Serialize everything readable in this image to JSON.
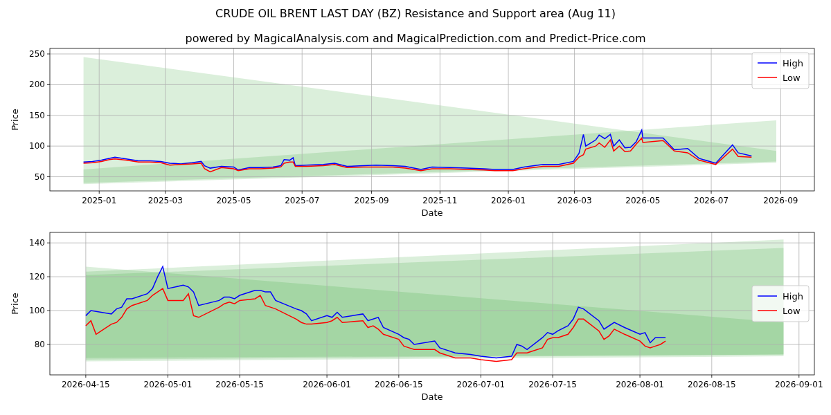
{
  "figure": {
    "title": "CRUDE OIL BRENT LAST DAY (BZ) Resistance and Support area (Aug 11)",
    "subtitle": "powered by MagicalAnalysis.com and MagicalPrediction.com and Predict-Price.com"
  },
  "charts": [
    {
      "chart_data": {
        "type": "line",
        "xlabel": "Date",
        "ylabel": "Price",
        "x": [
          "2024-12-18",
          "2024-12-26",
          "2025-01-03",
          "2025-01-10",
          "2025-01-15",
          "2025-01-25",
          "2025-02-05",
          "2025-02-15",
          "2025-02-25",
          "2025-03-05",
          "2025-03-15",
          "2025-03-25",
          "2025-04-02",
          "2025-04-05",
          "2025-04-10",
          "2025-04-20",
          "2025-05-01",
          "2025-05-05",
          "2025-05-15",
          "2025-05-25",
          "2025-06-05",
          "2025-06-12",
          "2025-06-15",
          "2025-06-20",
          "2025-06-23",
          "2025-06-25",
          "2025-07-05",
          "2025-07-20",
          "2025-07-30",
          "2025-08-10",
          "2025-08-25",
          "2025-09-05",
          "2025-09-20",
          "2025-10-01",
          "2025-10-15",
          "2025-10-25",
          "2025-11-10",
          "2025-11-25",
          "2025-12-10",
          "2025-12-20",
          "2026-01-05",
          "2026-01-15",
          "2026-02-01",
          "2026-02-15",
          "2026-02-28",
          "2026-03-05",
          "2026-03-09",
          "2026-03-11",
          "2026-03-20",
          "2026-03-23",
          "2026-03-28",
          "2026-04-02",
          "2026-04-05",
          "2026-04-10",
          "2026-04-15",
          "2026-04-20",
          "2026-04-25",
          "2026-04-30",
          "2026-05-01",
          "2026-05-19",
          "2026-05-29",
          "2026-06-10",
          "2026-06-20",
          "2026-07-05",
          "2026-07-20",
          "2026-07-25",
          "2026-08-06"
        ],
        "series": [
          {
            "name": "High",
            "color": "#0000ff",
            "values": [
              74,
              75,
              77,
              80,
              82,
              79,
              76,
              76,
              75,
              72,
              71,
              73,
              75,
              68,
              64,
              67,
              66,
              61,
              65,
              65,
              66,
              68,
              78,
              77,
              81,
              68,
              69,
              70,
              72,
              67,
              68,
              69,
              68,
              67,
              62,
              66,
              65,
              64,
              63,
              62,
              62,
              66,
              70,
              70,
              75,
              88,
              119,
              100,
              110,
              118,
              112,
              119,
              100,
              110,
              97,
              98,
              107,
              126,
              113,
              113,
              94,
              96,
              80,
              72,
              102,
              89,
              84
            ]
          },
          {
            "name": "Low",
            "color": "#ff0000",
            "values": [
              72,
              73,
              75,
              78,
              79,
              77,
              74,
              74,
              73,
              69,
              70,
              71,
              72,
              63,
              58,
              65,
              63,
              60,
              63,
              63,
              64,
              66,
              72,
              74,
              74,
              67,
              67,
              68,
              70,
              65,
              66,
              66,
              66,
              64,
              60,
              63,
              63,
              62,
              61,
              60,
              60,
              63,
              67,
              67,
              72,
              82,
              86,
              95,
              100,
              105,
              98,
              110,
              92,
              100,
              91,
              92,
              103,
              113,
              106,
              109,
              92,
              89,
              77,
              70,
              95,
              83,
              82
            ]
          }
        ],
        "xlim": [
          "2024-11-18",
          "2026-10-01"
        ],
        "ylim": [
          27,
          259
        ],
        "xticks": [
          {
            "value": "2025-01-01",
            "label": "2025-01"
          },
          {
            "value": "2025-03-01",
            "label": "2025-03"
          },
          {
            "value": "2025-05-01",
            "label": "2025-05"
          },
          {
            "value": "2025-07-01",
            "label": "2025-07"
          },
          {
            "value": "2025-09-01",
            "label": "2025-09"
          },
          {
            "value": "2025-11-01",
            "label": "2025-11"
          },
          {
            "value": "2026-01-01",
            "label": "2026-01"
          },
          {
            "value": "2026-03-01",
            "label": "2026-03"
          },
          {
            "value": "2026-05-01",
            "label": "2026-05"
          },
          {
            "value": "2026-07-01",
            "label": "2026-07"
          },
          {
            "value": "2026-09-01",
            "label": "2026-09"
          }
        ],
        "yticks": [
          50,
          100,
          150,
          200,
          250
        ],
        "grid": true,
        "legend": true
      }
    },
    {
      "chart_data": {
        "type": "line",
        "xlabel": "Date",
        "ylabel": "Price",
        "x": [
          "2026-04-15",
          "2026-04-16",
          "2026-04-17",
          "2026-04-20",
          "2026-04-21",
          "2026-04-22",
          "2026-04-23",
          "2026-04-24",
          "2026-04-27",
          "2026-04-28",
          "2026-04-29",
          "2026-04-30",
          "2026-05-01",
          "2026-05-04",
          "2026-05-05",
          "2026-05-06",
          "2026-05-07",
          "2026-05-11",
          "2026-05-12",
          "2026-05-13",
          "2026-05-14",
          "2026-05-15",
          "2026-05-18",
          "2026-05-19",
          "2026-05-20",
          "2026-05-21",
          "2026-05-22",
          "2026-05-26",
          "2026-05-27",
          "2026-05-28",
          "2026-05-29",
          "2026-06-01",
          "2026-06-02",
          "2026-06-03",
          "2026-06-04",
          "2026-06-08",
          "2026-06-09",
          "2026-06-10",
          "2026-06-11",
          "2026-06-12",
          "2026-06-15",
          "2026-06-16",
          "2026-06-17",
          "2026-06-18",
          "2026-06-22",
          "2026-06-23",
          "2026-06-26",
          "2026-06-29",
          "2026-07-01",
          "2026-07-04",
          "2026-07-07",
          "2026-07-08",
          "2026-07-09",
          "2026-07-10",
          "2026-07-13",
          "2026-07-14",
          "2026-07-15",
          "2026-07-16",
          "2026-07-18",
          "2026-07-19",
          "2026-07-20",
          "2026-07-21",
          "2026-07-24",
          "2026-07-25",
          "2026-07-26",
          "2026-07-27",
          "2026-07-29",
          "2026-08-01",
          "2026-08-02",
          "2026-08-03",
          "2026-08-04",
          "2026-08-05",
          "2026-08-06"
        ],
        "series": [
          {
            "name": "High",
            "color": "#0000ff",
            "values": [
              97,
              100,
              99.5,
              98,
              101,
              102,
              107,
              107,
              110,
              113,
              120,
              126,
              113,
              115,
              114,
              111,
              103,
              106,
              108,
              108,
              107,
              109,
              112,
              112,
              111,
              111,
              106,
              101,
              100,
              98,
              94,
              97,
              96,
              99,
              96,
              98,
              94,
              95,
              96,
              90,
              86,
              84,
              83,
              80,
              82,
              78,
              75,
              74,
              73,
              72,
              73,
              80,
              79,
              77,
              84,
              87,
              86,
              88,
              91,
              95,
              102,
              101,
              94,
              89,
              91,
              93,
              90,
              86,
              87,
              81,
              84,
              84,
              84
            ]
          },
          {
            "name": "Low",
            "color": "#ff0000",
            "values": [
              91,
              94,
              86,
              92,
              93,
              96,
              101,
              103,
              106,
              109,
              111,
              113,
              106,
              106,
              110,
              97,
              96,
              102,
              104,
              105,
              104,
              106,
              107,
              109,
              103,
              102,
              101,
              95,
              93,
              92,
              92,
              93,
              94,
              96,
              93,
              94,
              90,
              91,
              89,
              86,
              83,
              79,
              78,
              77,
              77,
              75,
              72,
              72,
              71,
              70,
              71,
              75,
              75,
              75,
              78,
              83,
              84,
              84,
              86,
              90,
              95,
              95,
              88,
              83,
              85,
              89,
              86,
              82,
              79,
              78,
              79,
              80,
              82
            ]
          }
        ],
        "xlim": [
          "2026-04-08",
          "2026-09-04"
        ],
        "ylim": [
          62,
          146.2
        ],
        "xticks": [
          {
            "value": "2026-04-15",
            "label": "2026-04-15"
          },
          {
            "value": "2026-05-01",
            "label": "2026-05-01"
          },
          {
            "value": "2026-05-15",
            "label": "2026-05-15"
          },
          {
            "value": "2026-06-01",
            "label": "2026-06-01"
          },
          {
            "value": "2026-06-15",
            "label": "2026-06-15"
          },
          {
            "value": "2026-07-01",
            "label": "2026-07-01"
          },
          {
            "value": "2026-07-15",
            "label": "2026-07-15"
          },
          {
            "value": "2026-08-01",
            "label": "2026-08-01"
          },
          {
            "value": "2026-08-15",
            "label": "2026-08-15"
          },
          {
            "value": "2026-09-01",
            "label": "2026-09-01"
          }
        ],
        "yticks": [
          80,
          100,
          120,
          140
        ],
        "grid": true,
        "legend": true
      }
    }
  ]
}
